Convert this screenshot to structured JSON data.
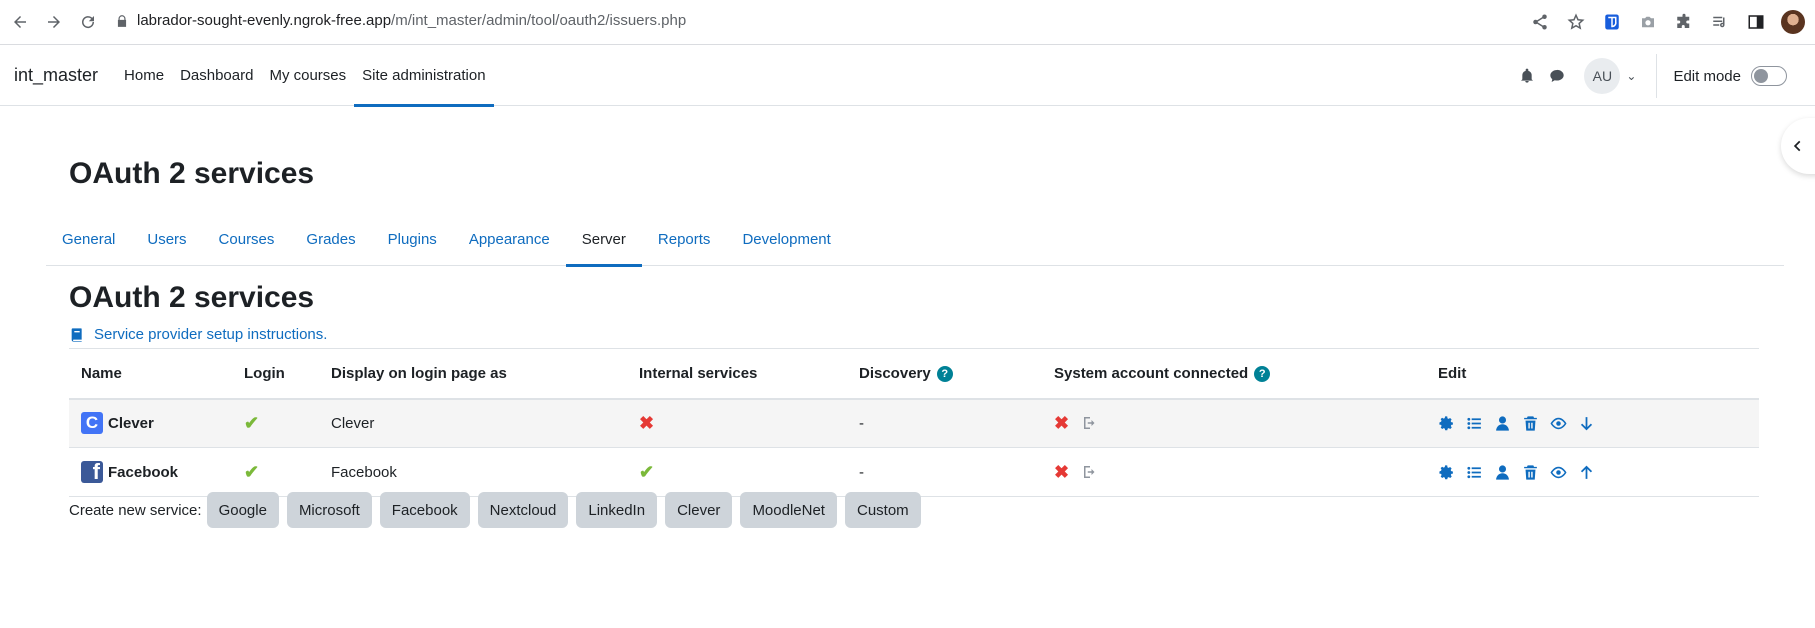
{
  "browser": {
    "url_host": "labrador-sought-evenly.ngrok-free.app",
    "url_path": "/m/int_master/admin/tool/oauth2/issuers.php"
  },
  "navbar": {
    "brand": "int_master",
    "items": [
      {
        "label": "Home"
      },
      {
        "label": "Dashboard"
      },
      {
        "label": "My courses"
      },
      {
        "label": "Site administration"
      }
    ],
    "active_item": "Site administration",
    "user_initials": "AU",
    "edit_mode_label": "Edit mode"
  },
  "page": {
    "title": "OAuth 2 services",
    "tabs": [
      {
        "label": "General"
      },
      {
        "label": "Users"
      },
      {
        "label": "Courses"
      },
      {
        "label": "Grades"
      },
      {
        "label": "Plugins"
      },
      {
        "label": "Appearance"
      },
      {
        "label": "Server"
      },
      {
        "label": "Reports"
      },
      {
        "label": "Development"
      }
    ],
    "active_tab": "Server",
    "section_title": "OAuth 2 services",
    "instructions_link": "Service provider setup instructions."
  },
  "table": {
    "headers": {
      "name": "Name",
      "login": "Login",
      "display": "Display on login page as",
      "internal": "Internal services",
      "discovery": "Discovery",
      "system": "System account connected",
      "edit": "Edit"
    },
    "rows": [
      {
        "name": "Clever",
        "login": true,
        "display": "Clever",
        "internal": false,
        "discovery": "-",
        "system": false,
        "logo": "clever-logo"
      },
      {
        "name": "Facebook",
        "login": true,
        "display": "Facebook",
        "internal": true,
        "discovery": "-",
        "system": false,
        "logo": "facebook-logo"
      }
    ]
  },
  "create": {
    "label": "Create new service:",
    "buttons": [
      "Google",
      "Microsoft",
      "Facebook",
      "Nextcloud",
      "LinkedIn",
      "Clever",
      "MoodleNet",
      "Custom"
    ]
  },
  "colors": {
    "link": "#0f6cbf",
    "check": "#7bb93a",
    "cross": "#e53935",
    "help": "#008196",
    "button_bg": "#ced4da"
  }
}
